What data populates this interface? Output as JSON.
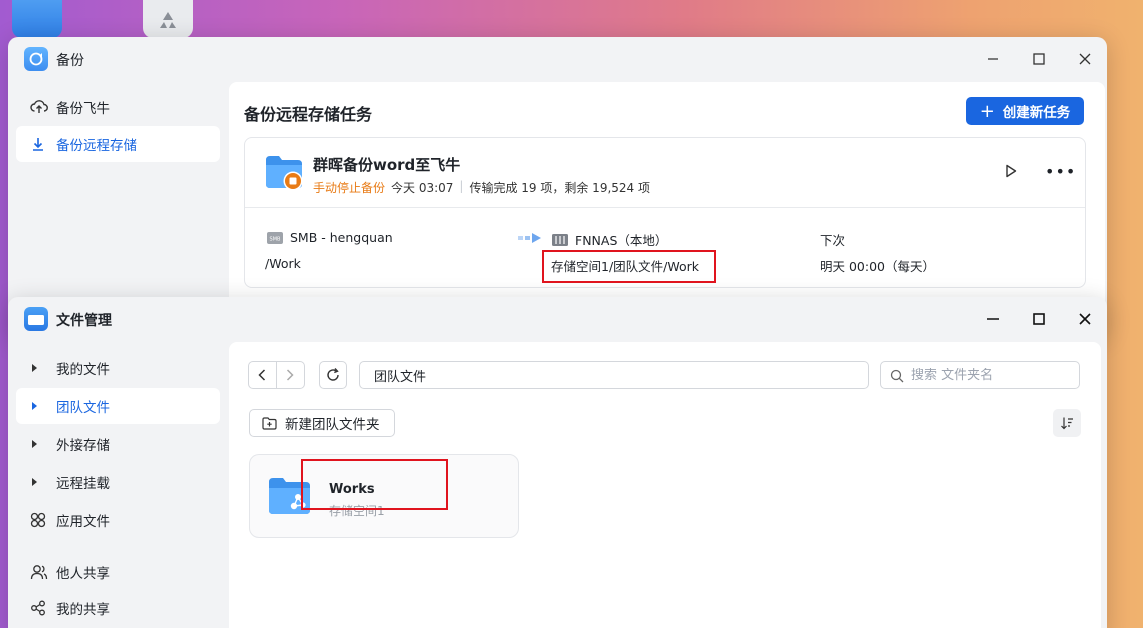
{
  "colors": {
    "accent": "#1a66e0",
    "warning": "#e87b16",
    "highlight": "#e0141e"
  },
  "backup_window": {
    "title": "备份",
    "sidebar": [
      {
        "label": "备份飞牛",
        "icon": "upload-cloud-icon"
      },
      {
        "label": "备份远程存储",
        "icon": "download-icon"
      }
    ],
    "heading": "备份远程存储任务",
    "create_button": "创建新任务",
    "task": {
      "name": "群晖备份word至飞牛",
      "status": "手动停止备份",
      "time": "今天 03:07",
      "progress": "传输完成 19 项，剩余 19,524 项",
      "source_name": "SMB - hengquan",
      "source_path": "/Work",
      "target_name": "FNNAS（本地）",
      "target_path": "存储空间1/团队文件/Work",
      "next_label": "下次",
      "next_value": "明天 00:00（每天）"
    }
  },
  "files_window": {
    "title": "文件管理",
    "sidebar": [
      {
        "label": "我的文件",
        "icon": "caret-right-icon"
      },
      {
        "label": "团队文件",
        "icon": "caret-right-icon"
      },
      {
        "label": "外接存储",
        "icon": "caret-right-icon"
      },
      {
        "label": "远程挂载",
        "icon": "caret-right-icon"
      },
      {
        "label": "应用文件",
        "icon": "apps-icon"
      },
      {
        "label": "他人共享",
        "icon": "users-icon"
      },
      {
        "label": "我的共享",
        "icon": "share-icon"
      }
    ],
    "path": "团队文件",
    "search_placeholder": "搜索 文件夹名",
    "new_folder_button": "新建团队文件夹",
    "folder": {
      "name": "Works",
      "location": "存储空间1"
    }
  }
}
